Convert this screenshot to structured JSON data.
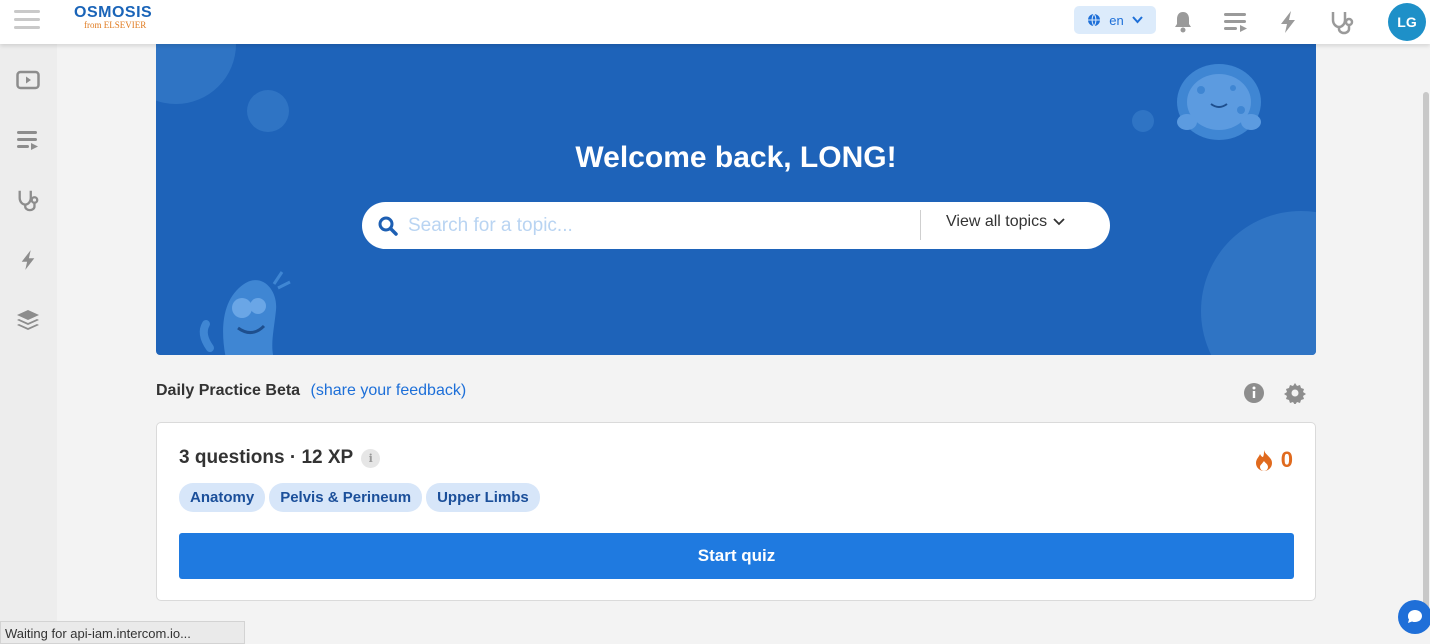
{
  "header": {
    "logo_brand": "OSMOSIS",
    "logo_sub": "from ELSEVIER",
    "language": "en",
    "avatar_initials": "LG"
  },
  "sidebar": {
    "items": [
      {
        "icon": "video-icon"
      },
      {
        "icon": "playlist-icon"
      },
      {
        "icon": "stethoscope-icon"
      },
      {
        "icon": "lightning-icon"
      },
      {
        "icon": "layers-icon"
      }
    ]
  },
  "hero": {
    "title": "Welcome back, LONG!",
    "search_placeholder": "Search for a topic...",
    "view_all_label": "View all topics"
  },
  "daily_practice": {
    "title": "Daily Practice Beta",
    "feedback_link": "(share your feedback)",
    "card": {
      "summary": "3 questions · 12 XP",
      "streak": "0",
      "tags": [
        "Anatomy",
        "Pelvis & Perineum",
        "Upper Limbs"
      ],
      "start_label": "Start quiz"
    }
  },
  "status": {
    "text": "Waiting for api-iam.intercom.io..."
  },
  "colors": {
    "brand_blue": "#1e63b9",
    "button_blue": "#1f7ae0",
    "streak_orange": "#e06a1e"
  }
}
